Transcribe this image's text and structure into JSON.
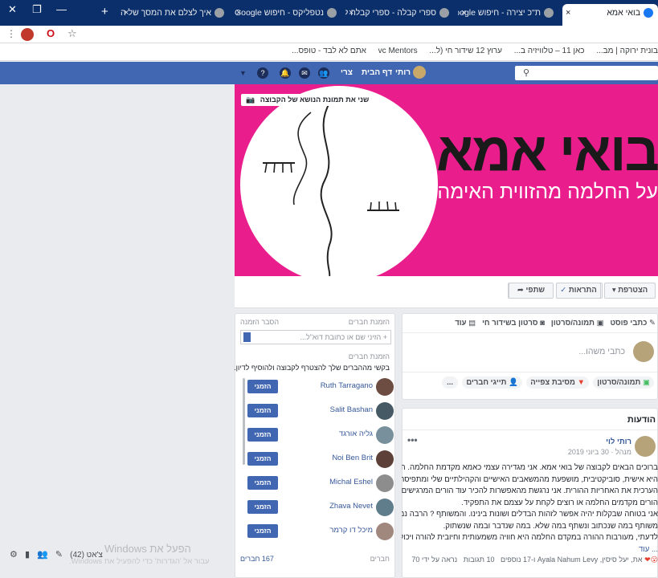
{
  "browser": {
    "tabs": [
      {
        "title": "בואי אמא",
        "active": true
      },
      {
        "title": "ת\"כ יצירה - חיפוש Google",
        "active": false
      },
      {
        "title": "ספרי קבלה - ספרי קבלה לנ",
        "active": false
      },
      {
        "title": "נטפליקס - חיפוש Google",
        "active": false
      },
      {
        "title": "איך לצלם את המסך של הנו",
        "active": false
      }
    ],
    "new_tab": "+",
    "close_symbol": "×",
    "bookmarks": [
      "בונית ירוקה | מב...",
      "כאן 11 – טלוויזיה ב...",
      "ערוץ 12 שידור חי (ל...",
      "vc Mentors",
      "אתם לא לבד - טופס..."
    ]
  },
  "fb_nav": {
    "user": "רותי",
    "home": "דף הבית",
    "create": "צרי",
    "search_placeholder": ""
  },
  "cover": {
    "title": "בואי אמא",
    "subtitle": "על החלמה מהזווית האימהית",
    "change_cover": "שני את תמונת הנושא של הקבוצה"
  },
  "actions": {
    "joined": "הצטרפת",
    "notifications": "התראות",
    "share": "שתפי",
    "more": "עוד"
  },
  "composer": {
    "tabs": [
      "כתבי פוסט",
      "תמונה/סרטון",
      "סרטון בשידור חי",
      "עוד"
    ],
    "placeholder": "כתבי משהו...",
    "options": [
      "תמונה/סרטון",
      "מסיבת צפייה",
      "תייגי חברים",
      "..."
    ]
  },
  "invite_panel": {
    "title": "הזמנת חברים",
    "hint_label": "הסבר הזמנה",
    "input_placeholder": "+ הזיני שם או כתובת דוא\"ל...",
    "suggest_title": "הזמנת חברים",
    "suggest_text": "בקשי מההברים שלך להצטרף לקבוצה ולהוסיף לדיון.",
    "invite_label": "הזמני",
    "members": [
      "Ruth Tarragano",
      "Salit Bashan",
      "גליה אורגד",
      "Noi Ben Brit",
      "Michal Eshel",
      "Zhava Nevet",
      "מיכל דו קרמר"
    ],
    "members_label": "חברים",
    "members_count": "167 חברים"
  },
  "announcements": {
    "title": "הודעות",
    "author": "רותי לוי",
    "role": "מנהל",
    "date": "30 ביוני 2019",
    "lines": [
      "ברוכים הבאים לקבוצה של בואי אמא. אני מגדירה עצמי כאמא מקדמת החלמה. ההגדרה",
      "היא אישית, סוביקטיבית, מושפעת מהמשאבים האישיים והקהילתיים שלי ומתפיסתי",
      "הערכית את האחריות ההורית. אני נרגשת מהאפשרות להכיר עוד הורים המרגישים שהם",
      "הורים מקדמים החלמה או רוצים לקחת על עצמם את התפקיד.",
      "אני בטוחה שבקלות יהיה אפשר לזהות הבדלים ושונות בינינו. והמשותף ? הרבה נמצא",
      "משותף במה שנכתוב ונשתף במה שלא. במה שנדבר ובמה שנשתוק.",
      "לדעתי, מעורבות ההורה במקדם החלמה היא חוויה משמעותית וחיובית להורה ויכולה לתר",
      "... עוד"
    ],
    "footer_reactions": "את, יעל סיסין, Ayala Nahum Levy ו-17 נוספים",
    "footer_comments": "10 תגובות",
    "footer_seen": "נראה על ידי 70"
  },
  "chat": {
    "label": "צ'אט (42)"
  },
  "windows": {
    "activate_title": "הפעל את Windows",
    "activate_text": "עבור אל 'הגדרות' כדי להפעיל את Windows."
  },
  "colors": {
    "fb_blue": "#4267b2",
    "cover_pink": "#e91e8c",
    "tab_bar": "#0b2f6b"
  }
}
